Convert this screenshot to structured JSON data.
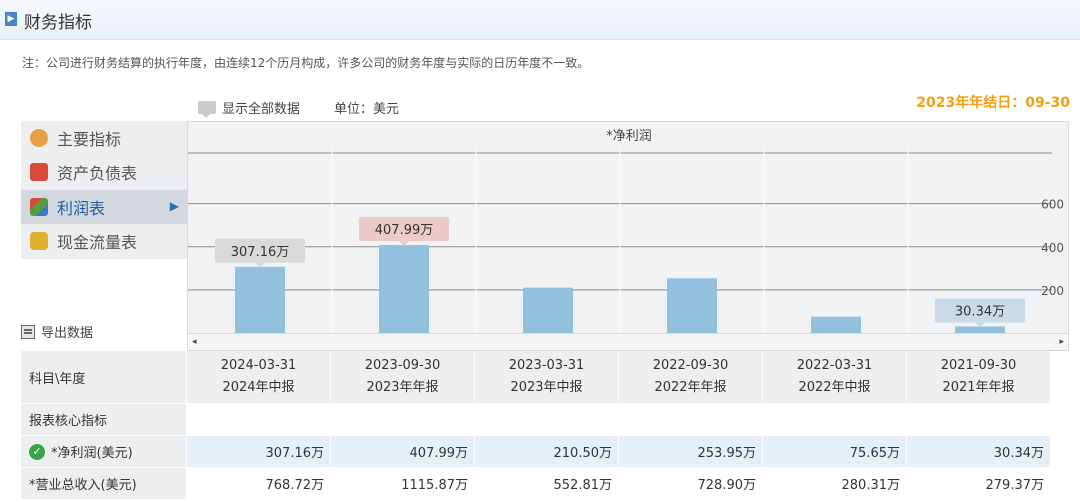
{
  "header": {
    "marker": "▶",
    "title": "财务指标"
  },
  "note": "注：公司进行财务结算的执行年度，由连续12个历月构成，许多公司的财务年度与实际的日历年度不一致。",
  "controls": {
    "show_all_label": "显示全部数据",
    "unit_label": "单位：美元",
    "year_end_label": "2023年年结日：09-30"
  },
  "menu": {
    "items": [
      {
        "label": "主要指标",
        "icon": "gear-icon",
        "color": "#e8a040"
      },
      {
        "label": "资产负债表",
        "icon": "document-icon",
        "color": "#d94a3a"
      },
      {
        "label": "利润表",
        "icon": "cube-icon",
        "color": "#5a9a40",
        "active": true
      },
      {
        "label": "现金流量表",
        "icon": "coins-icon",
        "color": "#e0b030"
      }
    ],
    "active_arrow": "▶"
  },
  "export_label": "导出数据",
  "chart_data": {
    "type": "bar",
    "title": "*净利润",
    "categories": [
      "2024-03-31",
      "2023-09-30",
      "2023-03-31",
      "2022-09-30",
      "2022-03-31",
      "2021-09-30"
    ],
    "values": [
      307.16,
      407.99,
      210.5,
      253.95,
      75.65,
      30.34
    ],
    "y_ticks": [
      200,
      400,
      600
    ],
    "ylim": [
      0,
      800
    ],
    "bar_color": "#93c0de",
    "tooltips": [
      {
        "index": 0,
        "text": "307.16万",
        "bg": "#d9d9d9"
      },
      {
        "index": 1,
        "text": "407.99万",
        "bg": "#eccaca"
      },
      {
        "index": 5,
        "text": "30.34万",
        "bg": "#c9dbe9"
      }
    ]
  },
  "scroll": {
    "left": "◂",
    "right": "▸"
  },
  "table": {
    "corner": "科目\\年度",
    "columns": [
      {
        "date": "2024-03-31",
        "type": "2024年中报"
      },
      {
        "date": "2023-09-30",
        "type": "2023年年报"
      },
      {
        "date": "2023-03-31",
        "type": "2023年中报"
      },
      {
        "date": "2022-09-30",
        "type": "2022年年报"
      },
      {
        "date": "2022-03-31",
        "type": "2022年中报"
      },
      {
        "date": "2021-09-30",
        "type": "2021年年报"
      }
    ],
    "section_label": "报表核心指标",
    "rows": [
      {
        "label": "*净利润(美元)",
        "checked": true,
        "values": [
          "307.16万",
          "407.99万",
          "210.50万",
          "253.95万",
          "75.65万",
          "30.34万"
        ]
      },
      {
        "label": "*营业总收入(美元)",
        "checked": false,
        "values": [
          "768.72万",
          "1115.87万",
          "552.81万",
          "728.90万",
          "280.31万",
          "279.37万"
        ]
      }
    ]
  }
}
